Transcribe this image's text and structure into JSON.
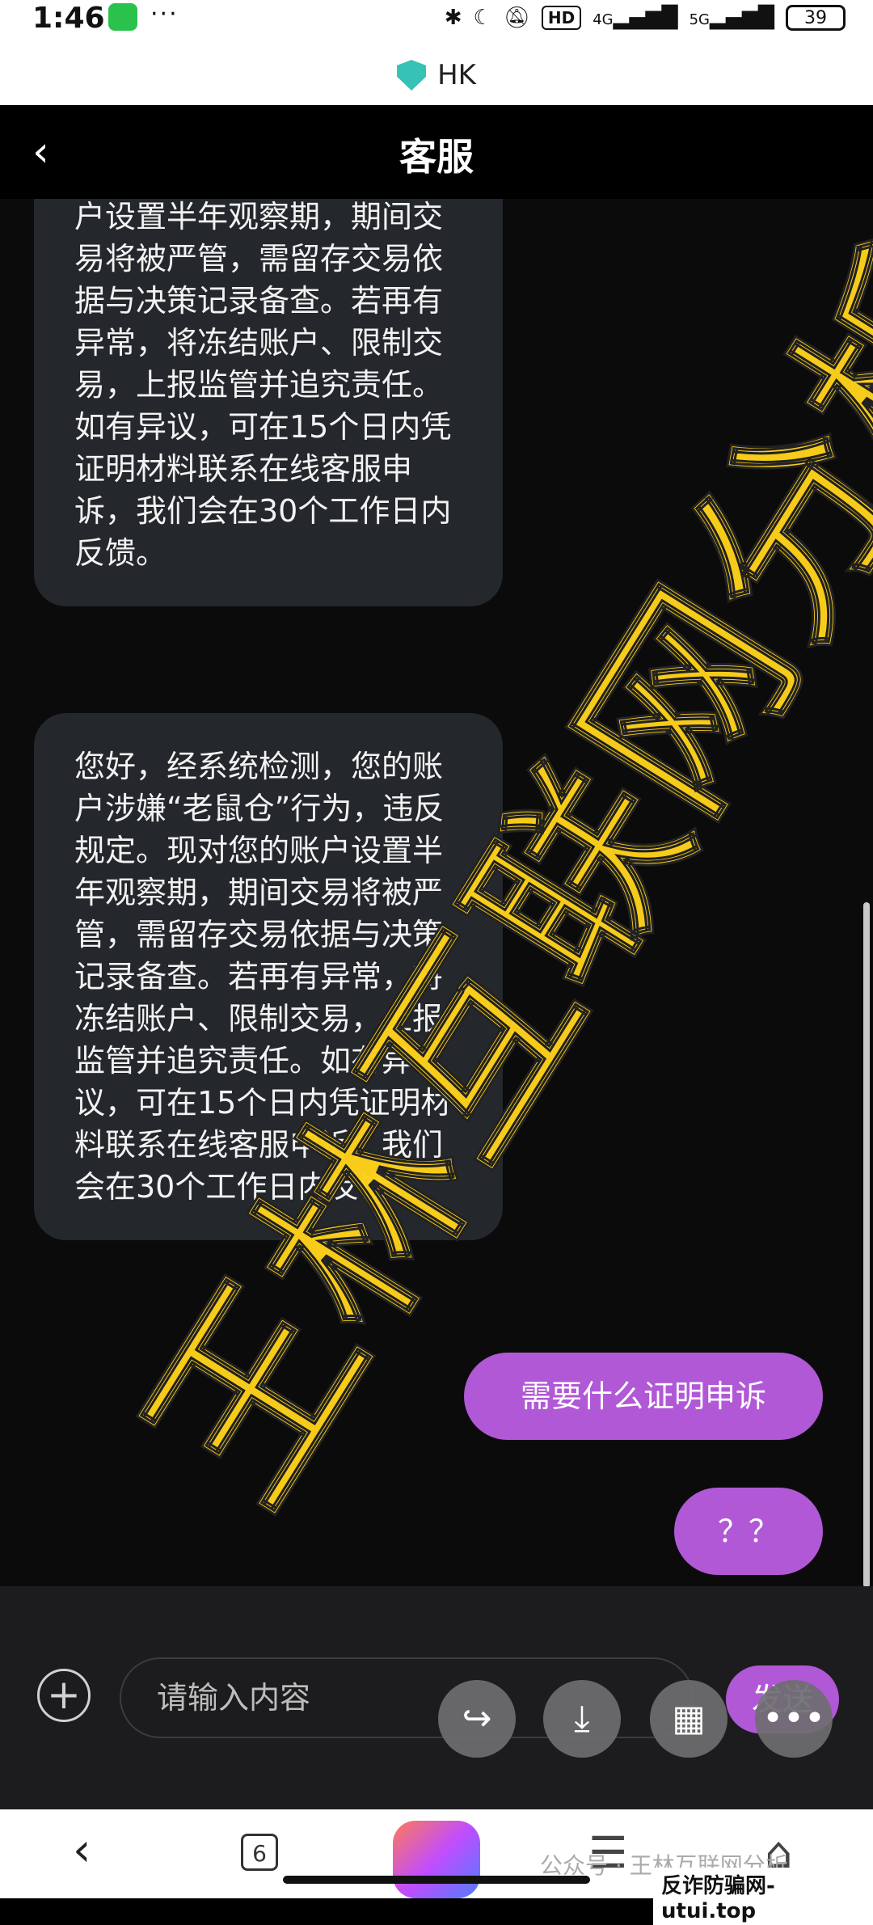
{
  "status_bar": {
    "time": "1:46",
    "dots": "···",
    "hd": "HD",
    "net1": "4G",
    "net2": "5G",
    "battery": "39"
  },
  "browser": {
    "url_label": "HK"
  },
  "header": {
    "back_glyph": "‹",
    "title": "客服"
  },
  "chat": {
    "messages_in": [
      "为，违反规定。现对您的账户设置半年观察期，期间交易将被严管，需留存交易依据与决策记录备查。若再有异常，将冻结账户、限制交易，上报监管并追究责任。如有异议，可在15个日内凭证明材料联系在线客服申诉，我们会在30个工作日内反馈。",
      "您好，经系统检测，您的账户涉嫌“老鼠仓”行为，违反规定。现对您的账户设置半年观察期，期间交易将被严管，需留存交易依据与决策记录备查。若再有异常，将冻结账户、限制交易，上报监管并追究责任。如有异议，可在15个日内凭证明材料联系在线客服申诉，我们会在30个工作日内反馈。"
    ],
    "messages_out": [
      "需要什么证明申诉",
      "？？"
    ]
  },
  "input": {
    "placeholder": "请输入内容",
    "send_label": "发送",
    "plus_glyph": "+"
  },
  "fabs": {
    "share": "↪",
    "download": "⤓",
    "apps": "▦",
    "more": "•••"
  },
  "nav": {
    "back": "‹",
    "tabs_count": "6",
    "menu": "☰",
    "home": "⌂"
  },
  "overlay": {
    "watermark_text": "王林互联网分析",
    "account_text": "公众号 · 王林互联网分析",
    "site_text": "反诈防骗网-utui.top"
  },
  "colors": {
    "accent": "#b158d6",
    "bubble_in": "#24272b",
    "watermark": "#ffd21a"
  }
}
